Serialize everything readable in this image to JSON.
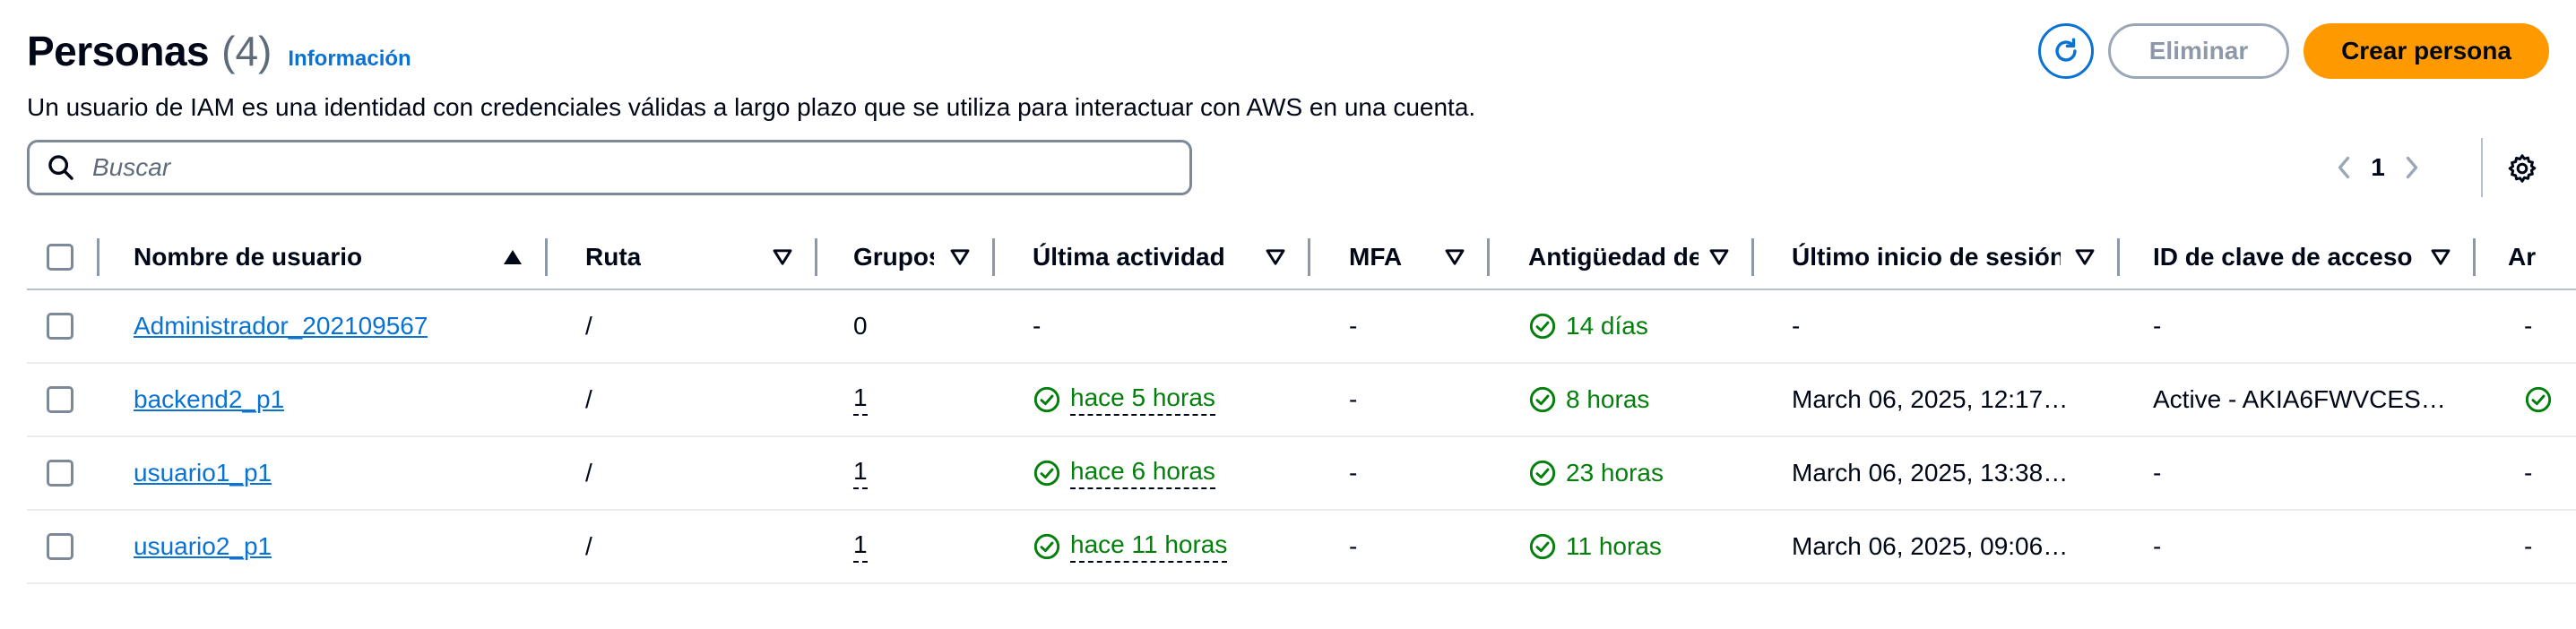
{
  "header": {
    "title": "Personas",
    "count": "(4)",
    "info_link": "Información",
    "description": "Un usuario de IAM es una identidad con credenciales válidas a largo plazo que se utiliza para interactuar con AWS en una cuenta."
  },
  "actions": {
    "refresh_icon": "refresh-icon",
    "delete_label": "Eliminar",
    "create_label": "Crear persona"
  },
  "search": {
    "placeholder": "Buscar",
    "value": ""
  },
  "pagination": {
    "current_page": "1"
  },
  "colors": {
    "accent": "#0972d3",
    "primary_button": "#ff9900",
    "success": "#037f0c"
  },
  "table": {
    "columns": [
      "Nombre de usuario",
      "Ruta",
      "Grupos",
      "Última actividad",
      "MFA",
      "Antigüedad de",
      "Último inicio de sesión",
      "ID de clave de acceso",
      "Ar"
    ],
    "rows": [
      {
        "user": "Administrador_202109567",
        "path": "/",
        "groups": "0",
        "last_activity": "-",
        "mfa": "-",
        "age": "14 días",
        "last_login": "-",
        "access_key": "-",
        "extra": "-"
      },
      {
        "user": "backend2_p1",
        "path": "/",
        "groups": "1",
        "last_activity": "hace 5 horas",
        "mfa": "-",
        "age": "8 horas",
        "last_login": "March 06, 2025, 12:17…",
        "access_key": "Active - AKIA6FWVCES…",
        "extra": ""
      },
      {
        "user": "usuario1_p1",
        "path": "/",
        "groups": "1",
        "last_activity": "hace 6 horas",
        "mfa": "-",
        "age": "23 horas",
        "last_login": "March 06, 2025, 13:38…",
        "access_key": "-",
        "extra": "-"
      },
      {
        "user": "usuario2_p1",
        "path": "/",
        "groups": "1",
        "last_activity": "hace 11 horas",
        "mfa": "-",
        "age": "11 horas",
        "last_login": "March 06, 2025, 09:06…",
        "access_key": "-",
        "extra": "-"
      }
    ]
  }
}
